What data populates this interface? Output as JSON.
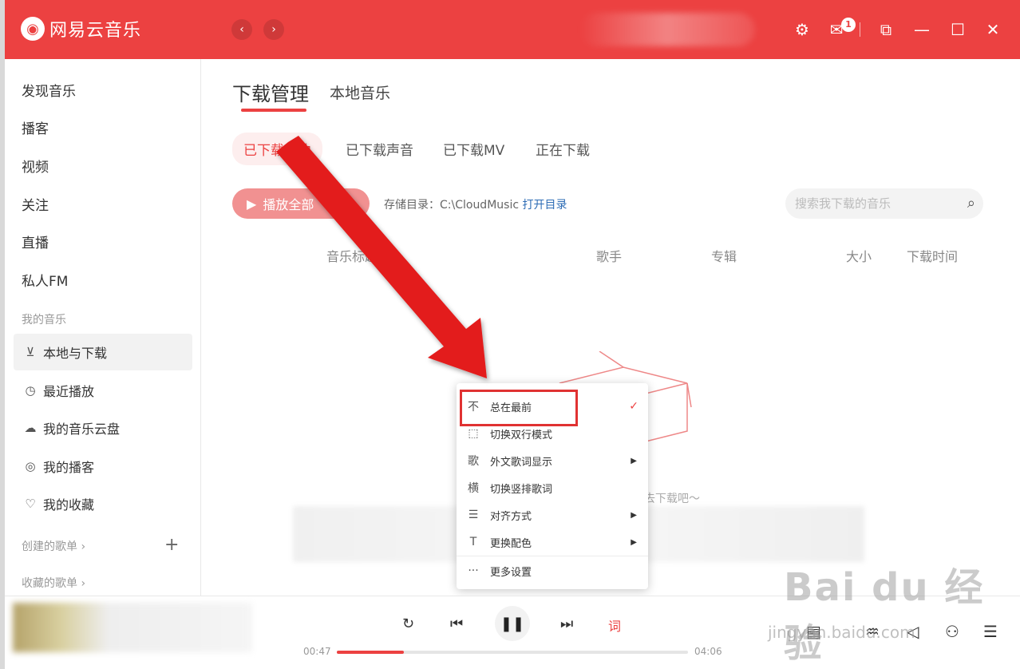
{
  "app": {
    "logo_mark": "◉",
    "logo_text": "网易云音乐",
    "back_icon": "‹",
    "forward_icon": "›",
    "mail_badge": "1"
  },
  "sidebar": {
    "items": [
      {
        "label": "发现音乐"
      },
      {
        "label": "播客"
      },
      {
        "label": "视频"
      },
      {
        "label": "关注"
      },
      {
        "label": "直播"
      },
      {
        "label": "私人FM"
      }
    ],
    "my_music_title": "我的音乐",
    "my_music": [
      {
        "label": "本地与下载",
        "icon": "download-icon",
        "glyph": "⊻",
        "active": true
      },
      {
        "label": "最近播放",
        "icon": "history-icon",
        "glyph": "◷"
      },
      {
        "label": "我的音乐云盘",
        "icon": "cloud-icon",
        "glyph": "☁"
      },
      {
        "label": "我的播客",
        "icon": "podcast-icon",
        "glyph": "◎"
      },
      {
        "label": "我的收藏",
        "icon": "favorite-icon",
        "glyph": "♡"
      }
    ],
    "created_playlists": "创建的歌单 ›",
    "collected_playlists": "收藏的歌单 ›",
    "plus": "+"
  },
  "main": {
    "tabs": [
      "下载管理",
      "本地音乐"
    ],
    "sub_tabs": [
      "已下载单曲",
      "已下载声音",
      "已下载MV",
      "正在下载"
    ],
    "play_all": "播放全部",
    "add": "+",
    "storage_label": "存储目录：C:\\CloudMusic",
    "open_dir": "打开目录",
    "search_placeholder": "搜索我下载的音乐",
    "columns": [
      "音乐标题",
      "歌手",
      "专辑",
      "大小",
      "下载时间"
    ],
    "empty_text": "快去下载吧～"
  },
  "context_menu": {
    "items": [
      {
        "label": "总在最前",
        "glyph": "不",
        "checked": true
      },
      {
        "label": "切换双行模式",
        "glyph": "⬚"
      },
      {
        "label": "外文歌词显示",
        "glyph": "歌",
        "submenu": true
      },
      {
        "label": "切换竖排歌词",
        "glyph": "横"
      },
      {
        "label": "对齐方式",
        "glyph": "☰",
        "submenu": true
      },
      {
        "label": "更换配色",
        "glyph": "T",
        "submenu": true
      },
      {
        "label": "更多设置",
        "glyph": "···"
      }
    ],
    "check_glyph": "✓",
    "arrow_glyph": "▶"
  },
  "player": {
    "current_time": "00:47",
    "total_time": "04:06",
    "progress": 0.19,
    "lyric_label": "词"
  },
  "watermark": {
    "main": "Bai du 经验",
    "sub": "jingyan.baidu.com"
  },
  "colors": {
    "accent": "#ec4141",
    "arrow": "#e31e1e"
  }
}
